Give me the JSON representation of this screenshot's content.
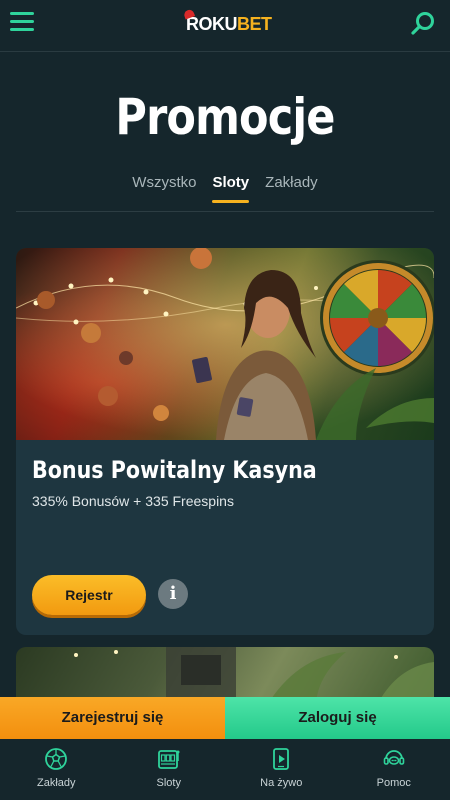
{
  "header": {
    "logo_roku": "ROKU",
    "logo_bet": "BET"
  },
  "page": {
    "title": "Promocje"
  },
  "tabs": [
    {
      "label": "Wszystko",
      "active": false
    },
    {
      "label": "Sloty",
      "active": true
    },
    {
      "label": "Zakłady",
      "active": false
    }
  ],
  "promo": {
    "title": "Bonus Powitalny Kasyna",
    "subtitle": "335% Bonusów + 335 Freespins",
    "register_label": "Rejestr",
    "info_label": "i"
  },
  "cta": {
    "register_label": "Zarejestruj się",
    "login_label": "Zaloguj się"
  },
  "bottom_nav": [
    {
      "label": "Zakłady",
      "icon": "soccer-ball-icon"
    },
    {
      "label": "Sloty",
      "icon": "slot-machine-icon"
    },
    {
      "label": "Na żywo",
      "icon": "live-play-icon"
    },
    {
      "label": "Pomoc",
      "icon": "chat-support-icon"
    }
  ],
  "colors": {
    "background": "#15262c",
    "accent_green": "#2fd39b",
    "accent_orange": "#f6b21f",
    "card": "#1e3640"
  }
}
